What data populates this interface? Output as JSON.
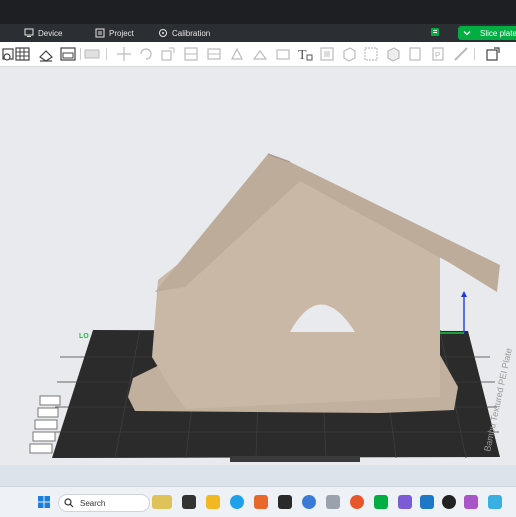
{
  "nav": {
    "device_label": "Device",
    "project_label": "Project",
    "calibration_label": "Calibration",
    "slice_label": "Slice plate"
  },
  "plate": {
    "edge_text": "Bambu Textured PEI Plate"
  },
  "taskbar": {
    "search_placeholder": "Search"
  },
  "colors": {
    "accent": "#00ae42",
    "model": "#c9b8a6",
    "plate": "#2b2b2b",
    "axis_z": "#1f3bd6",
    "axis_y": "#19c23e"
  },
  "toolbar_icons": [
    "add-part-icon",
    "arrange-grid-icon",
    "place-on-face-icon",
    "split-window-icon",
    "layout-icon",
    "move-icon",
    "rotate-icon",
    "scale-icon",
    "cut-icon",
    "mesh-boolean-icon",
    "paint-support-icon",
    "seam-paint-icon",
    "text-tool-icon",
    "measure-icon",
    "assembly-icon",
    "variable-layer-icon",
    "cube-view-icon",
    "object-icon",
    "plate-icon",
    "ruler-icon",
    "settings-export-icon"
  ]
}
